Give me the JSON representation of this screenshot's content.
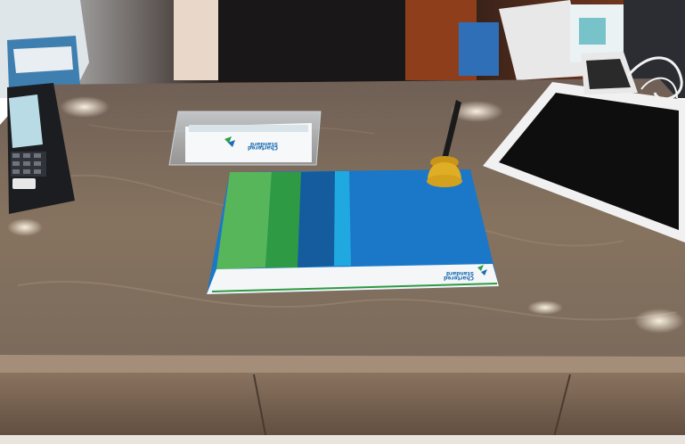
{
  "scene": {
    "description_label": "",
    "brand_primary": "Standard",
    "brand_secondary": "Chartered",
    "colors": {
      "counter_top": "#7f6c5e",
      "counter_front": "#6f5a4a",
      "mat_light_green": "#58b65a",
      "mat_green": "#2f9a44",
      "mat_dark_blue": "#145c9e",
      "mat_cyan": "#20a9e1",
      "mat_blue": "#1b78c8",
      "pen_stand": "#e0ae24",
      "tablet_frame": "#f1f1f1",
      "tablet_screen": "#0e0e0e",
      "card_terminal": "#1b1d21"
    }
  }
}
